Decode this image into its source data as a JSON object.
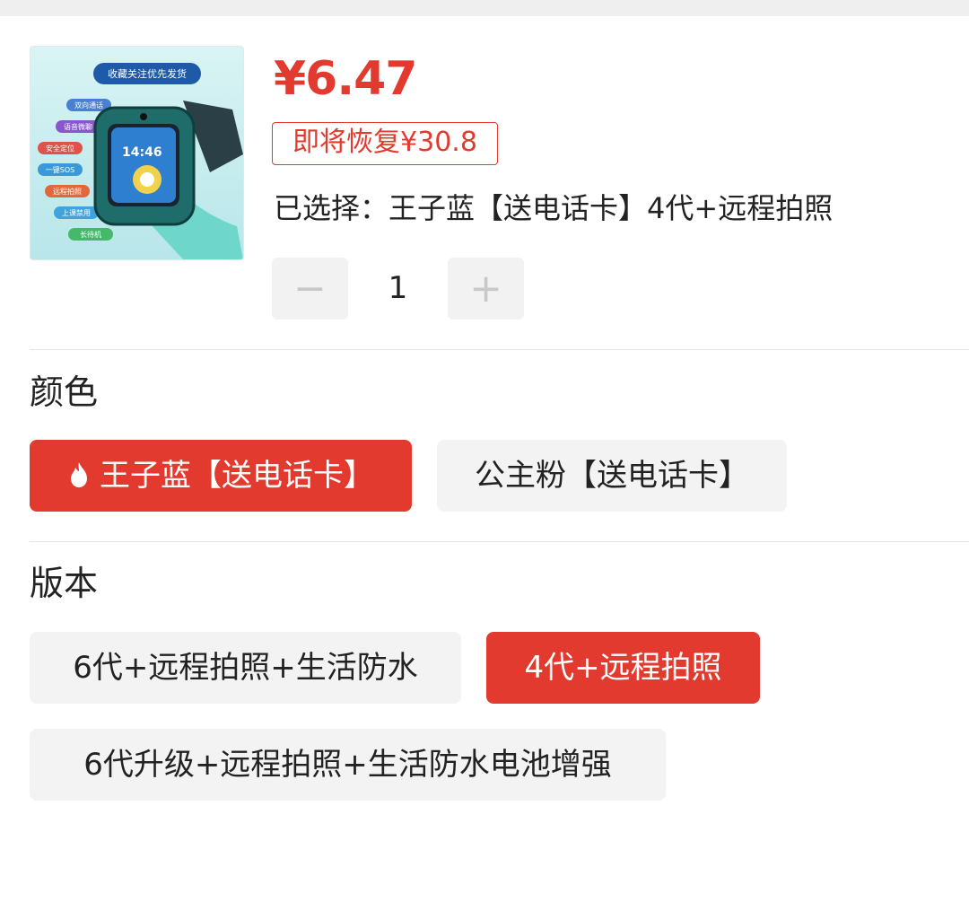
{
  "product": {
    "price": "¥6.47",
    "restore_badge": "即将恢复¥30.8",
    "selected_prefix": "已选择：",
    "selected_value": "王子蓝【送电话卡】4代+远程拍照",
    "image_banner": "收藏关注优先发货",
    "image_features": [
      "双向通话",
      "语音微聊",
      "安全定位",
      "一键SOS",
      "远程拍照",
      "上课禁用",
      "长待机"
    ],
    "image_time": "14:46"
  },
  "quantity": {
    "minus_label": "−",
    "value": "1",
    "plus_label": "+"
  },
  "color_section": {
    "title": "颜色",
    "options": [
      {
        "label": "王子蓝【送电话卡】",
        "selected": true,
        "icon": "fire-icon"
      },
      {
        "label": "公主粉【送电话卡】",
        "selected": false
      }
    ]
  },
  "version_section": {
    "title": "版本",
    "options": [
      {
        "label": "6代+远程拍照+生活防水",
        "selected": false
      },
      {
        "label": "4代+远程拍照",
        "selected": true
      },
      {
        "label": "6代升级+远程拍照+生活防水电池增强",
        "selected": false
      }
    ]
  },
  "colors": {
    "accent": "#e23a2e",
    "option_bg": "#f3f3f3"
  }
}
